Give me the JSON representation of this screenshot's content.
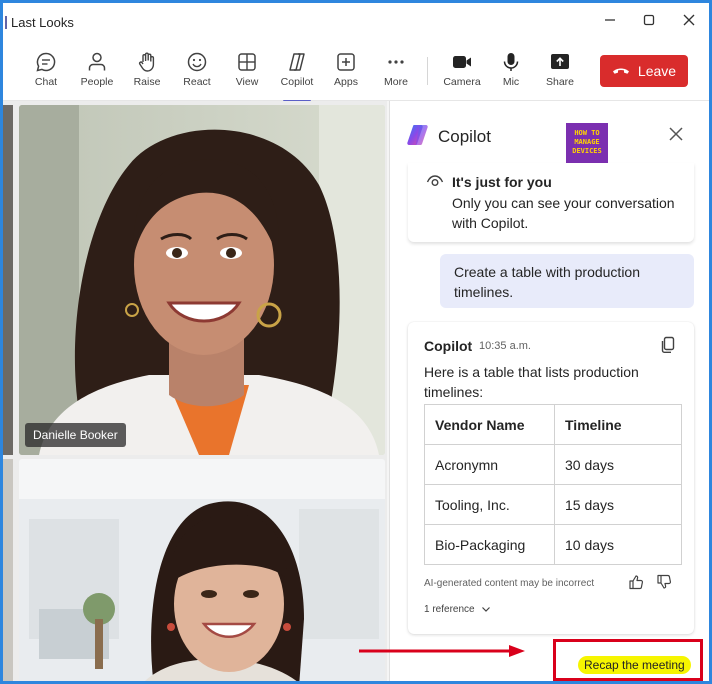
{
  "window": {
    "title": "Last Looks",
    "controls": [
      "minimize-icon",
      "maximize-icon",
      "close-icon"
    ]
  },
  "toolbar": {
    "items": [
      {
        "label": "Chat",
        "icon": "chat-icon"
      },
      {
        "label": "People",
        "icon": "people-icon"
      },
      {
        "label": "Raise",
        "icon": "raise-hand-icon"
      },
      {
        "label": "React",
        "icon": "smiley-icon"
      },
      {
        "label": "View",
        "icon": "grid-icon"
      },
      {
        "label": "Copilot",
        "icon": "copilot-icon",
        "active": true
      },
      {
        "label": "Apps",
        "icon": "apps-icon"
      },
      {
        "label": "More",
        "icon": "more-icon"
      },
      {
        "label": "Camera",
        "icon": "camera-icon"
      },
      {
        "label": "Mic",
        "icon": "mic-icon"
      },
      {
        "label": "Share",
        "icon": "share-icon"
      }
    ],
    "leave_label": "Leave",
    "leave_color": "#d92c2c",
    "accent": "#5b5fc7"
  },
  "video": {
    "tiles": [
      {
        "name": "Danielle Booker"
      },
      {
        "name": ""
      }
    ]
  },
  "copilot": {
    "title": "Copilot",
    "brand_logo_text": "HOW TO MANAGE DEVICES",
    "privacy": {
      "title": "It's just for you",
      "text": "Only you can see your conversation with Copilot."
    },
    "user_prompt": "Create a table with production timelines.",
    "reply": {
      "author": "Copilot",
      "time": "10:35 a.m.",
      "intro": "Here is a table that lists production timelines:",
      "table": {
        "headers": [
          "Vendor Name",
          "Timeline"
        ],
        "rows": [
          [
            "Acronymn",
            "30 days"
          ],
          [
            "Tooling, Inc.",
            "15 days"
          ],
          [
            "Bio-Packaging",
            "10 days"
          ]
        ]
      },
      "disclaimer": "AI-generated content may be incorrect",
      "references": "1 reference"
    },
    "suggestion": "Recap the meeting"
  }
}
